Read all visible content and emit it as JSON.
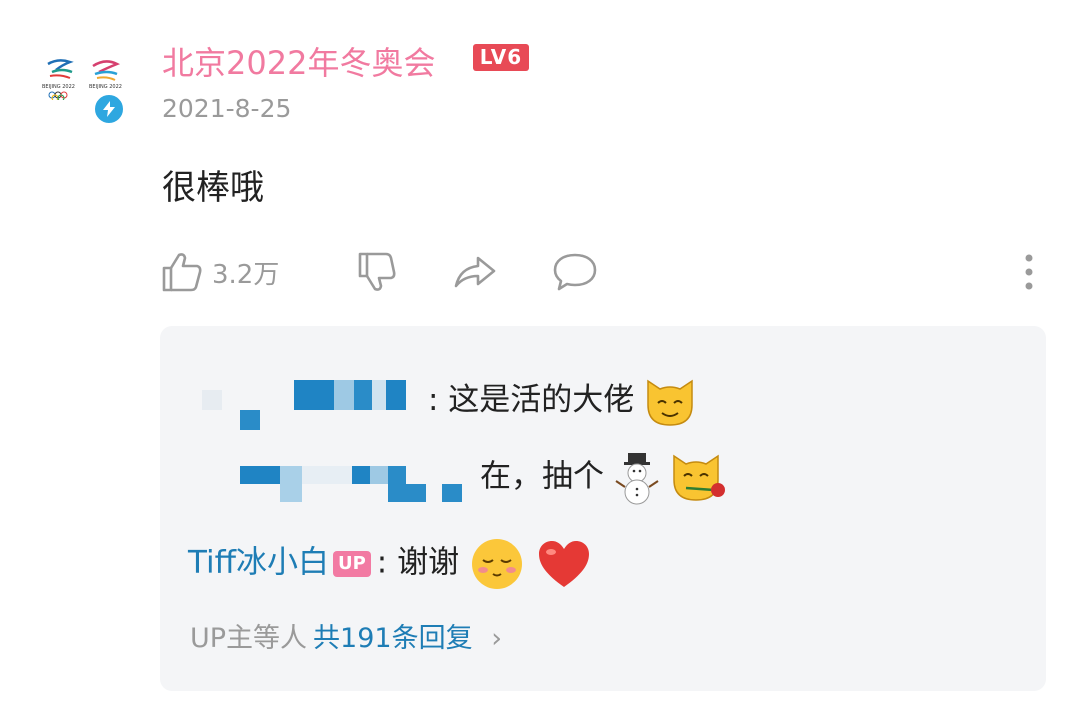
{
  "comment": {
    "username": "北京2022年冬奥会",
    "level": "LV6",
    "date": "2021-8-25",
    "text": "很棒哦",
    "like_count": "3.2万"
  },
  "avatar": {
    "emblem_caption": "BEIJING 2022"
  },
  "replies": [
    {
      "author": "",
      "text": ": 这是活的大佬"
    },
    {
      "author": "",
      "text": "在，抽个"
    },
    {
      "author": "Tiff冰小白",
      "badge": "UP",
      "text": ": 谢谢"
    }
  ],
  "more_replies": {
    "prefix": "UP主等人",
    "count_text": "共191条回复",
    "chevron": "›"
  },
  "colors": {
    "username": "#f17aa0",
    "level_badge": "#e84a56",
    "reply_author": "#1e7db5",
    "up_badge": "#f27aa3",
    "verify_badge": "#2ea7e0"
  },
  "icons": {
    "like": "thumbs-up-icon",
    "dislike": "thumbs-down-icon",
    "share": "share-icon",
    "reply": "comment-icon",
    "more": "more-vertical-icon"
  }
}
